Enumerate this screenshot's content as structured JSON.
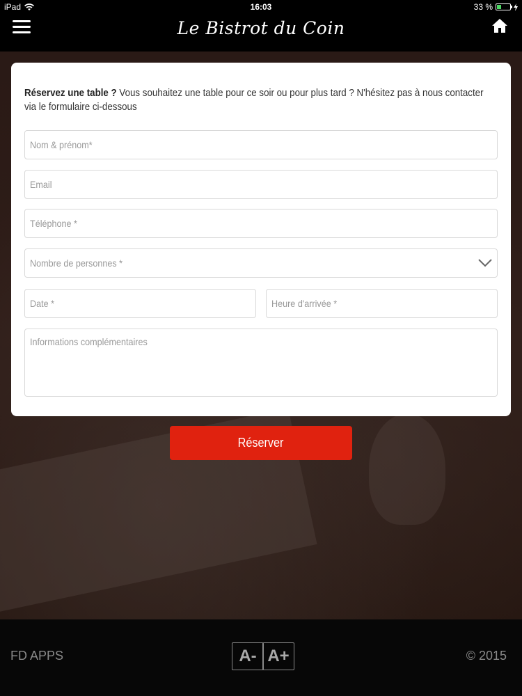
{
  "status_bar": {
    "device": "iPad",
    "time": "16:03",
    "battery": "33 %",
    "battery_level": 0.33
  },
  "nav": {
    "title": "Le Bistrot du Coin"
  },
  "form": {
    "intro_bold": "Réservez une table ?",
    "intro_text": " Vous souhaitez une table pour ce soir ou pour plus tard ? N'hésitez pas à nous contacter via le formulaire ci-dessous",
    "name_placeholder": "Nom & prénom*",
    "email_placeholder": "Email",
    "phone_placeholder": "Téléphone *",
    "persons_placeholder": "Nombre de personnes *",
    "date_placeholder": "Date *",
    "arrival_placeholder": "Heure d'arrivée *",
    "info_placeholder": "Informations complémentaires",
    "submit_label": "Réserver"
  },
  "footer": {
    "brand": "FD APPS",
    "font_decrease": "A-",
    "font_increase": "A+",
    "copyright": "© 2015"
  },
  "colors": {
    "accent": "#e0220f",
    "bar": "#000000"
  }
}
